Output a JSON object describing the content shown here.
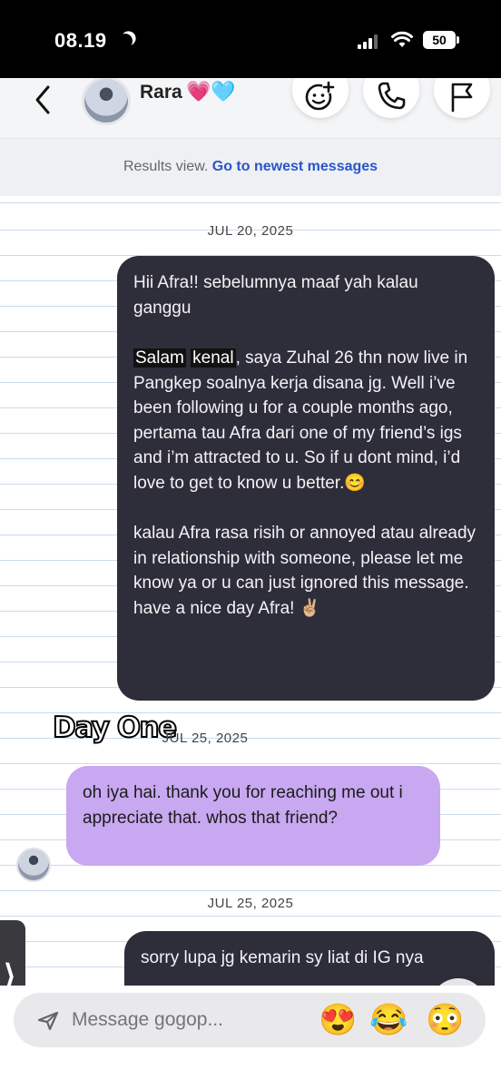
{
  "status_bar": {
    "time": "08.19",
    "battery": "50"
  },
  "header": {
    "contact_name": "Rara",
    "hearts": "💗🩵"
  },
  "banner": {
    "text": "Results view.",
    "link": "Go to newest messages"
  },
  "messages": [
    {
      "date": "JUL 20, 2025"
    },
    {
      "paragraph1": "Hii Afra!! sebelumnya maaf yah kalau ganggu",
      "highlight1": "Salam",
      "highlight2": "kenal",
      "paragraph2_rest": ", saya Zuhal 26 thn now live in Pangkep soalnya kerja disana jg. Well i’ve been following u for a couple months ago, pertama tau Afra dari one of my friend’s igs and i’m attracted to u. So if u dont mind, i’d love to get to know u better.😊",
      "paragraph3": "kalau Afra rasa risih or annoyed atau already in relationship with someone, please let me know ya or u can just ignored this message.  have a nice day Afra! ✌🏼"
    },
    {
      "date": "JUL 25, 2025",
      "sticker": "Day One"
    },
    {
      "text": "oh iya hai. thank you for reaching me out i appreciate that. whos that friend?"
    },
    {
      "date": "JUL 25, 2025"
    },
    {
      "text": "sorry lupa jg kemarin sy liat di IG nya"
    }
  ],
  "composer": {
    "placeholder": "Message gogop...",
    "emojis": [
      "😍",
      "😂",
      "😳"
    ]
  }
}
